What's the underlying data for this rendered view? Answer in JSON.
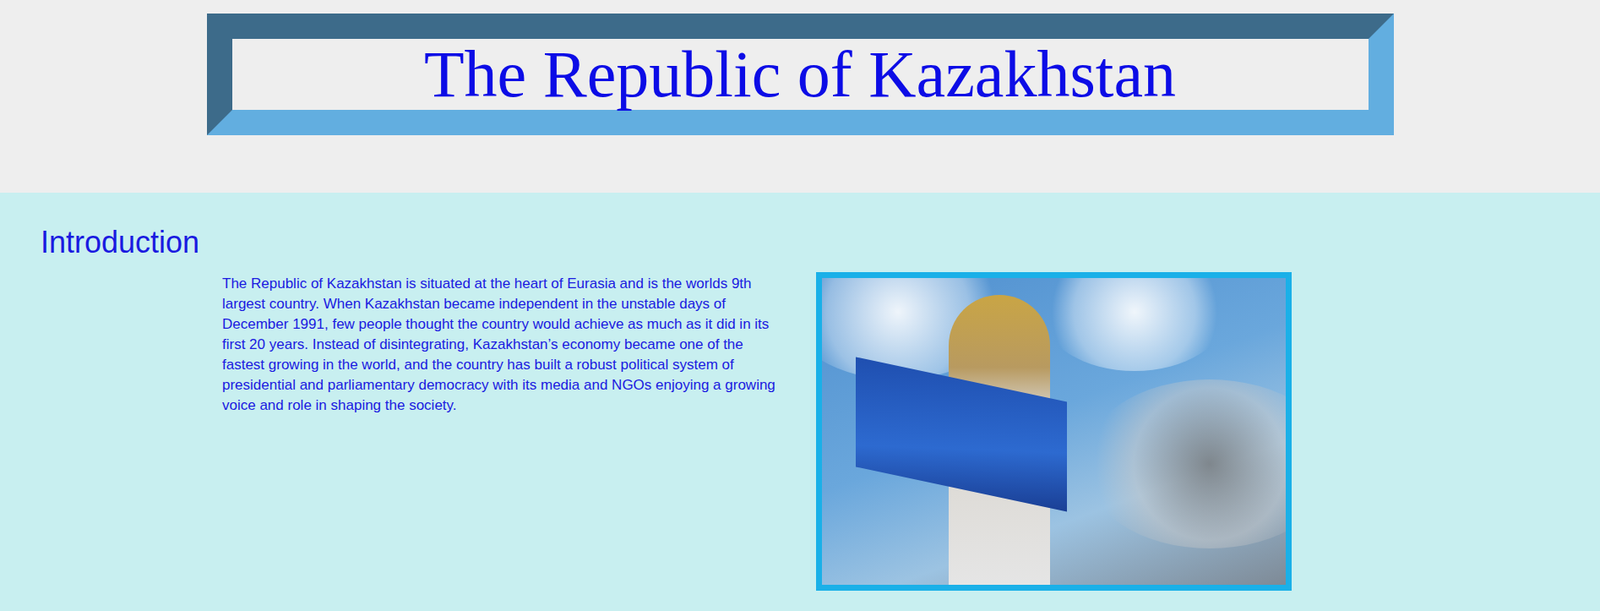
{
  "header": {
    "title": "The Republic of Kazakhstan"
  },
  "introduction": {
    "heading": "Introduction",
    "paragraph": "The Republic of Kazakhstan is situated at the heart of Eurasia and is the worlds 9th largest country. When Kazakhstan became independent in the unstable days of December 1991, few people thought the country would achieve as much as it did in its first 20 years. Instead of disintegrating, Kazakhstan’s economy became one of the fastest growing in the world, and the country has built a robust political system of presidential and parliamentary democracy with its media and NGOs enjoying a growing voice and role in shaping the society."
  }
}
